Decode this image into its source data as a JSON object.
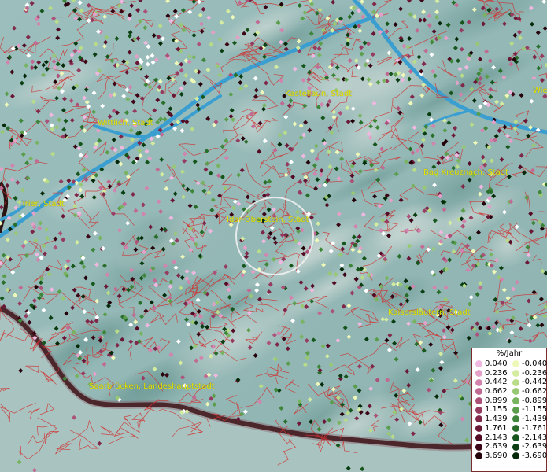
{
  "legend": {
    "title": "%/Jahr",
    "positive": [
      {
        "label": "0.040",
        "color": "#f0b8e0"
      },
      {
        "label": "0.236",
        "color": "#e4a0c8"
      },
      {
        "label": "0.442",
        "color": "#d284ae"
      },
      {
        "label": "0.662",
        "color": "#c06a94"
      },
      {
        "label": "0.899",
        "color": "#ac5278"
      },
      {
        "label": "1.155",
        "color": "#963c60"
      },
      {
        "label": "1.439",
        "color": "#80284a"
      },
      {
        "label": "1.761",
        "color": "#6a1836"
      },
      {
        "label": "2.143",
        "color": "#540c24"
      },
      {
        "label": "2.639",
        "color": "#3c0616"
      },
      {
        "label": "3.690",
        "color": "#24020a"
      }
    ],
    "negative": [
      {
        "label": "-0.040",
        "color": "#eef8b8"
      },
      {
        "label": "-0.236",
        "color": "#d4eca0"
      },
      {
        "label": "-0.442",
        "color": "#b8dc88"
      },
      {
        "label": "-0.662",
        "color": "#98c874"
      },
      {
        "label": "-0.899",
        "color": "#78b460"
      },
      {
        "label": "-1.155",
        "color": "#5a9e4c"
      },
      {
        "label": "-1.439",
        "color": "#3e863a"
      },
      {
        "label": "-1.761",
        "color": "#286e2a"
      },
      {
        "label": "-2.143",
        "color": "#16561c"
      },
      {
        "label": "-2.639",
        "color": "#0a3e12"
      },
      {
        "label": "-3.690",
        "color": "#042808"
      }
    ]
  },
  "cities": [
    {
      "name": "Kastellaun, Stadt"
    },
    {
      "name": "Wittlich, Stadt"
    },
    {
      "name": "Bad Kreuznach, Stadt"
    },
    {
      "name": "Trier, Stadt"
    },
    {
      "name": "Idar-Oberstein, Stadt"
    },
    {
      "name": "Kaiserslautern, Stadt"
    },
    {
      "name": "Saarbrücken, Landeshauptstadt"
    },
    {
      "name": "Wie"
    }
  ],
  "colors": {
    "terrain": "#8fb8b4",
    "river": "#3a9fd0",
    "boundaries": "#d03030",
    "label": "#e6e600",
    "white_dot": "#ffffff"
  }
}
